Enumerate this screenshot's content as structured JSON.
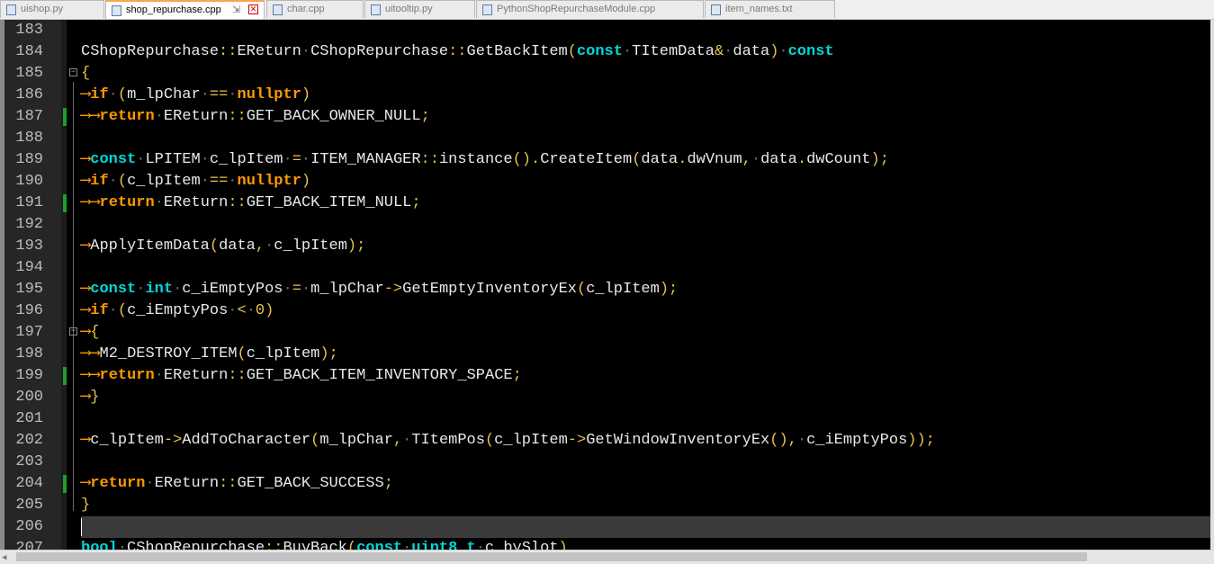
{
  "tabs": [
    {
      "label": "uishop.py"
    },
    {
      "label": "shop_repurchase.cpp"
    },
    {
      "label": "char.cpp"
    },
    {
      "label": "uitooltip.py"
    },
    {
      "label": "PythonShopRepurchaseModule.cpp"
    },
    {
      "label": "item_names.txt"
    }
  ],
  "tab_pin_glyph": "⇲",
  "tab_close_glyph": "✕",
  "colors": {
    "keyword": "#ff9900",
    "type": "#00d7d7",
    "operator": "#e7c14a",
    "text": "#e8e8e8",
    "line_number": "#bdbdbd",
    "modified_marker": "#1e9e2c",
    "current_line": "#3b3b3b"
  },
  "lines": [
    {
      "num": "183"
    },
    {
      "num": "184"
    },
    {
      "num": "185"
    },
    {
      "num": "186"
    },
    {
      "num": "187"
    },
    {
      "num": "188"
    },
    {
      "num": "189"
    },
    {
      "num": "190"
    },
    {
      "num": "191"
    },
    {
      "num": "192"
    },
    {
      "num": "193"
    },
    {
      "num": "194"
    },
    {
      "num": "195"
    },
    {
      "num": "196"
    },
    {
      "num": "197"
    },
    {
      "num": "198"
    },
    {
      "num": "199"
    },
    {
      "num": "200"
    },
    {
      "num": "201"
    },
    {
      "num": "202"
    },
    {
      "num": "203"
    },
    {
      "num": "204"
    },
    {
      "num": "205"
    },
    {
      "num": "206"
    },
    {
      "num": "207"
    }
  ],
  "code": {
    "l184": [
      "CShopRepurchase",
      "::",
      "EReturn",
      "·",
      "CShopRepurchase",
      "::",
      "GetBackItem",
      "(",
      "const",
      "·",
      "TItemData",
      "&",
      "·",
      "data",
      ")",
      "·",
      "const"
    ],
    "l185": [
      "{"
    ],
    "l186": [
      "⟶",
      "if",
      "·",
      "(",
      "m_lpChar",
      "·",
      "==",
      "·",
      "nullptr",
      ")"
    ],
    "l187": [
      "⟶",
      "⟶",
      "return",
      "·",
      "EReturn",
      "::",
      "GET_BACK_OWNER_NULL",
      ";"
    ],
    "l189": [
      "⟶",
      "const",
      "·",
      "LPITEM",
      "·",
      "c_lpItem",
      "·",
      "=",
      "·",
      "ITEM_MANAGER",
      "::",
      "instance",
      "()",
      ".",
      "CreateItem",
      "(",
      "data",
      ".",
      "dwVnum",
      ",",
      "·",
      "data",
      ".",
      "dwCount",
      ");"
    ],
    "l190": [
      "⟶",
      "if",
      "·",
      "(",
      "c_lpItem",
      "·",
      "==",
      "·",
      "nullptr",
      ")"
    ],
    "l191": [
      "⟶",
      "⟶",
      "return",
      "·",
      "EReturn",
      "::",
      "GET_BACK_ITEM_NULL",
      ";"
    ],
    "l193": [
      "⟶",
      "ApplyItemData",
      "(",
      "data",
      ",",
      "·",
      "c_lpItem",
      ");"
    ],
    "l195": [
      "⟶",
      "const",
      "·",
      "int",
      "·",
      "c_iEmptyPos",
      "·",
      "=",
      "·",
      "m_lpChar",
      "->",
      "GetEmptyInventoryEx",
      "(",
      "c_lpItem",
      ");"
    ],
    "l196": [
      "⟶",
      "if",
      "·",
      "(",
      "c_iEmptyPos",
      "·",
      "<",
      "·",
      "0",
      ")"
    ],
    "l197": [
      "⟶",
      "{"
    ],
    "l198": [
      "⟶",
      "⟶",
      "M2_DESTROY_ITEM",
      "(",
      "c_lpItem",
      ");"
    ],
    "l199": [
      "⟶",
      "⟶",
      "return",
      "·",
      "EReturn",
      "::",
      "GET_BACK_ITEM_INVENTORY_SPACE",
      ";"
    ],
    "l200": [
      "⟶",
      "}"
    ],
    "l202": [
      "⟶",
      "c_lpItem",
      "->",
      "AddToCharacter",
      "(",
      "m_lpChar",
      ",",
      "·",
      "TItemPos",
      "(",
      "c_lpItem",
      "->",
      "GetWindowInventoryEx",
      "(),",
      "·",
      "c_iEmptyPos",
      "));"
    ],
    "l204": [
      "⟶",
      "return",
      "·",
      "EReturn",
      "::",
      "GET_BACK_SUCCESS",
      ";"
    ],
    "l205": [
      "}"
    ],
    "l207": [
      "bool",
      "·",
      "CShopRepurchase",
      "::",
      "BuyBack",
      "(",
      "const",
      "·",
      "uint8_t",
      "·",
      "c_bySlot",
      ")"
    ]
  },
  "scroll": {
    "left_arrow": "◀"
  }
}
